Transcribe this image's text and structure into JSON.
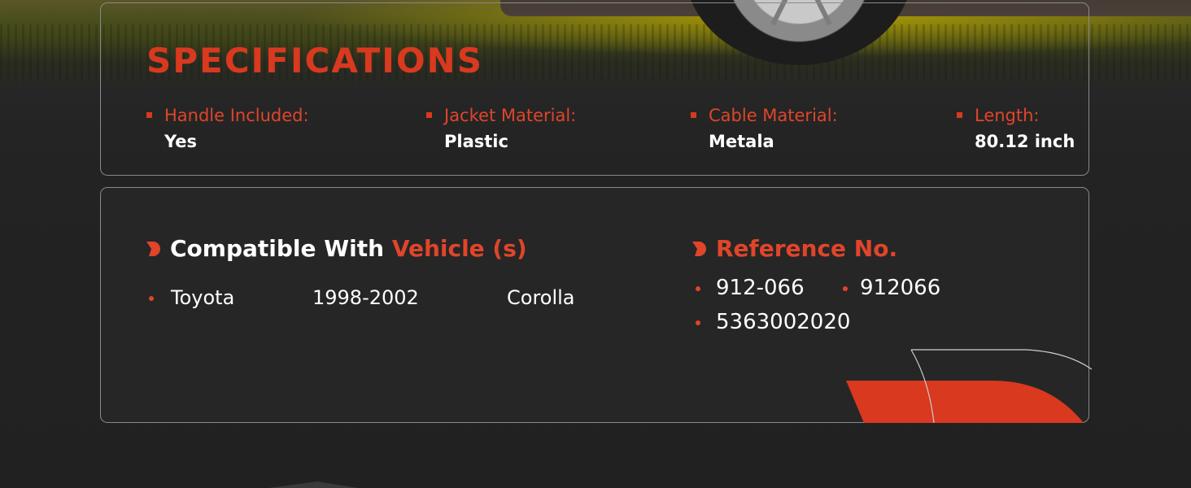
{
  "specifications": {
    "title": "SPECIFICATIONS",
    "items": [
      {
        "label": "Handle Included:",
        "value": "Yes"
      },
      {
        "label": "Jacket Material:",
        "value": "Plastic"
      },
      {
        "label": "Cable Material:",
        "value": "Metala"
      },
      {
        "label": "Length:",
        "value": "80.12 inch"
      }
    ]
  },
  "compatibility": {
    "heading_white": "Compatible With",
    "heading_accent": "Vehicle (s)",
    "vehicles": [
      {
        "make": "Toyota",
        "years": "1998-2002",
        "model": "Corolla"
      }
    ]
  },
  "reference": {
    "heading": "Reference No.",
    "numbers": [
      "912-066",
      "912066",
      "5363002020"
    ]
  },
  "colors": {
    "accent": "#d8391f",
    "background": "#222222",
    "text": "#ffffff",
    "panel_border": "#8a8a8a"
  },
  "icons": [
    "bullet-square-icon",
    "d-shape-icon",
    "bullet-dot-icon"
  ]
}
